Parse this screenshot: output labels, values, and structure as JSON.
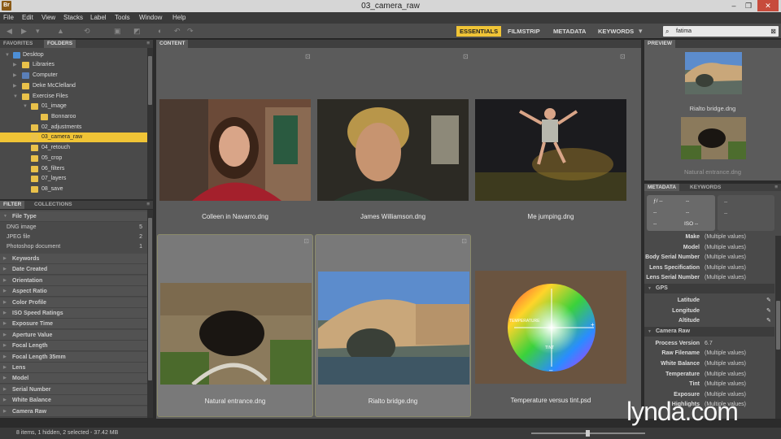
{
  "window": {
    "title": "03_camera_raw",
    "app_logo": "Br",
    "min": "–",
    "max": "❐",
    "close": "✕"
  },
  "menu": [
    "File",
    "Edit",
    "View",
    "Stacks",
    "Label",
    "Tools",
    "Window",
    "Help"
  ],
  "workspaces": {
    "essentials": "ESSENTIALS",
    "filmstrip": "FILMSTRIP",
    "metadata": "METADATA",
    "keywords": "KEYWORDS"
  },
  "search": {
    "value": "fatima",
    "icon": "search-icon"
  },
  "left_panel": {
    "tabs": [
      "FAVORITES",
      "FOLDERS"
    ],
    "folders": [
      {
        "label": "Desktop"
      },
      {
        "label": "Libraries"
      },
      {
        "label": "Computer"
      },
      {
        "label": "Deke McClelland"
      },
      {
        "label": "Exercise Files"
      },
      {
        "label": "01_image"
      },
      {
        "label": "Bonnaroo"
      },
      {
        "label": "02_adjustments"
      },
      {
        "label": "03_camera_raw"
      },
      {
        "label": "04_retouch"
      },
      {
        "label": "05_crop"
      },
      {
        "label": "06_filters"
      },
      {
        "label": "07_layers"
      },
      {
        "label": "08_save"
      }
    ]
  },
  "filter_panel": {
    "tabs": [
      "FILTER",
      "COLLECTIONS"
    ],
    "file_type": "File Type",
    "file_types": [
      {
        "label": "DNG image",
        "count": "5"
      },
      {
        "label": "JPEG file",
        "count": "2"
      },
      {
        "label": "Photoshop document",
        "count": "1"
      }
    ],
    "groups": [
      "Keywords",
      "Date Created",
      "Orientation",
      "Aspect Ratio",
      "Color Profile",
      "ISO Speed Ratings",
      "Exposure Time",
      "Aperture Value",
      "Focal Length",
      "Focal Length 35mm",
      "Lens",
      "Model",
      "Serial Number",
      "White Balance",
      "Camera Raw"
    ]
  },
  "content": {
    "tab": "CONTENT",
    "items": [
      {
        "caption": "Colleen in Navarro.dng",
        "selected": false
      },
      {
        "caption": "James Williamson.dng",
        "selected": false
      },
      {
        "caption": "Me jumping.dng",
        "selected": false
      },
      {
        "caption": "Natural entrance.dng",
        "selected": true
      },
      {
        "caption": "Rialto bridge.dng",
        "selected": true
      },
      {
        "caption": "Temperature versus tint.psd",
        "selected": false
      }
    ],
    "wheel_labels": {
      "temperature": "TEMPERATURE",
      "tint": "TINT",
      "plus": "+",
      "minus": "–"
    }
  },
  "preview": {
    "tab": "PREVIEW",
    "items": [
      {
        "caption": "Rialto bridge.dng"
      },
      {
        "caption": "Natural entrance.dng"
      }
    ]
  },
  "metadata_panel": {
    "tabs": [
      "METADATA",
      "KEYWORDS"
    ],
    "camera_box": {
      "f": "ƒ/ --",
      "a": "--",
      "b": "--",
      "c": "--",
      "iso": "ISO --",
      "d": "--",
      "e": "--",
      "g": "--"
    },
    "rows_top": [
      {
        "k": "Make",
        "v": "(Multiple values)"
      },
      {
        "k": "Model",
        "v": "(Multiple values)"
      },
      {
        "k": "Body Serial Number",
        "v": "(Multiple values)"
      },
      {
        "k": "Lens Specification",
        "v": "(Multiple values)"
      },
      {
        "k": "Lens Serial Number",
        "v": "(Multiple values)"
      }
    ],
    "gps_label": "GPS",
    "gps_rows": [
      {
        "k": "Latitude",
        "v": ""
      },
      {
        "k": "Longitude",
        "v": ""
      },
      {
        "k": "Altitude",
        "v": ""
      }
    ],
    "camera_raw_label": "Camera Raw",
    "cr_rows": [
      {
        "k": "Process Version",
        "v": "6.7"
      },
      {
        "k": "Raw Filename",
        "v": "(Multiple values)"
      },
      {
        "k": "White Balance",
        "v": "(Multiple values)"
      },
      {
        "k": "Temperature",
        "v": "(Multiple values)"
      },
      {
        "k": "Tint",
        "v": "(Multiple values)"
      },
      {
        "k": "Exposure",
        "v": "(Multiple values)"
      },
      {
        "k": "Highlights",
        "v": "(Multiple values)"
      }
    ]
  },
  "status": {
    "text": "8 items, 1 hidden, 2 selected - 37.42 MB"
  },
  "watermark": "lynda.com"
}
